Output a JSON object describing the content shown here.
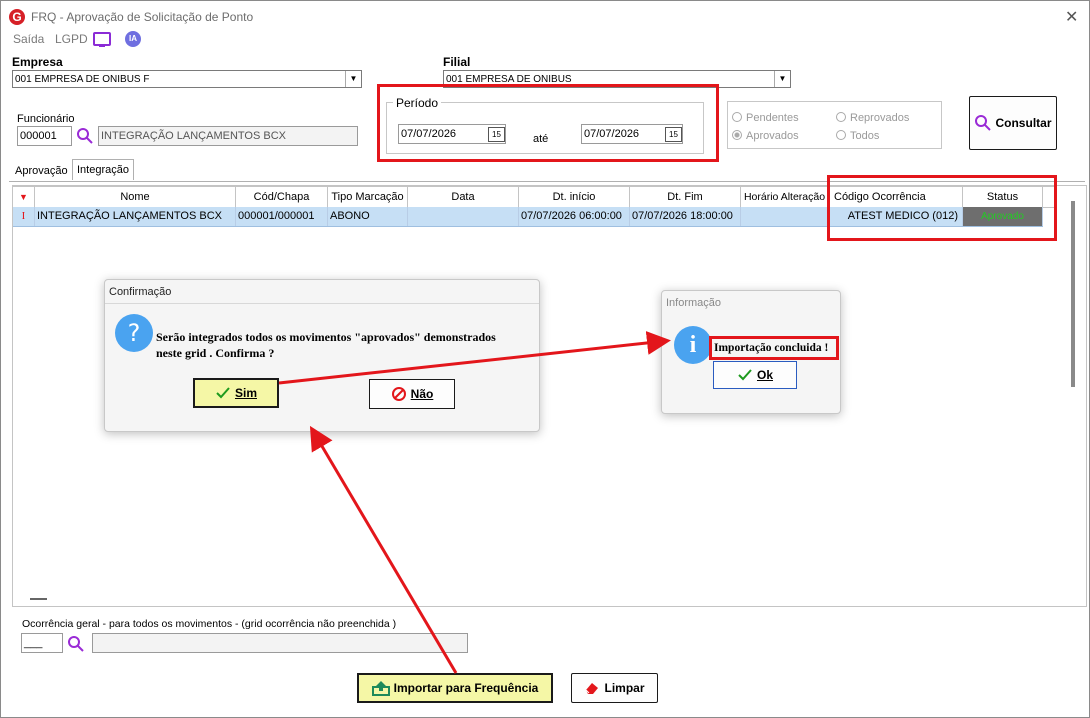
{
  "window": {
    "title": "FRQ - Aprovação de Solicitação de Ponto",
    "logo_letter": "G",
    "close_glyph": "✕"
  },
  "menu": {
    "saida": "Saída",
    "lgpd": "LGPD",
    "ia": "IA"
  },
  "empresa": {
    "label": "Empresa",
    "value": "001 EMPRESA DE ONIBUS F"
  },
  "filial": {
    "label": "Filial",
    "value": "001 EMPRESA DE ONIBUS"
  },
  "funcionario": {
    "label": "Funcionário",
    "code": "000001",
    "name": "INTEGRAÇÃO LANÇAMENTOS BCX"
  },
  "periodo": {
    "label": "Período",
    "start": "07/07/2026",
    "ate": "até",
    "end": "07/07/2026",
    "calendar_glyph": "15"
  },
  "status_filter": {
    "pendentes": "Pendentes",
    "reprovados": "Reprovados",
    "aprovados": "Aprovados",
    "todos": "Todos"
  },
  "consultar": {
    "label": "Consultar"
  },
  "tabs": [
    {
      "label": "Aprovação"
    },
    {
      "label": "Integração"
    }
  ],
  "grid": {
    "headers": [
      "Nome",
      "Cód/Chapa",
      "Tipo Marcação",
      "Data",
      "Dt. início",
      "Dt. Fim",
      "Horário Alteração",
      "Código Ocorrência",
      "Status"
    ],
    "rows": [
      {
        "marker": "I",
        "nome": "INTEGRAÇÃO LANÇAMENTOS BCX",
        "cod_chapa": "000001/000001",
        "tipo": "ABONO",
        "data": "",
        "dt_inicio": "07/07/2026 06:00:00",
        "dt_fim": "07/07/2026 18:00:00",
        "horario": "",
        "codigo": "ATEST MEDICO (012)",
        "status": "Aprovado"
      }
    ]
  },
  "confirm_dialog": {
    "title": "Confirmação",
    "message_line1": "Serão integrados todos os movimentos \"aprovados\" demonstrados",
    "message_line2": "neste grid . Confirma ?",
    "yes": "Sim",
    "no": "Não"
  },
  "info_dialog": {
    "title": "Informação",
    "message": "Importação concluida !",
    "ok": "Ok"
  },
  "ocorrencia_geral": {
    "label": "Ocorrência geral - para todos os movimentos - (grid ocorrência  não preenchida )",
    "code": "___"
  },
  "buttons": {
    "importar": "Importar para Frequência",
    "limpar": "Limpar"
  },
  "colors": {
    "highlight_red": "#e3161b",
    "row_selected": "#c6dff5",
    "status_ok": "#22cc22",
    "button_yellow": "#f5f7a6"
  }
}
